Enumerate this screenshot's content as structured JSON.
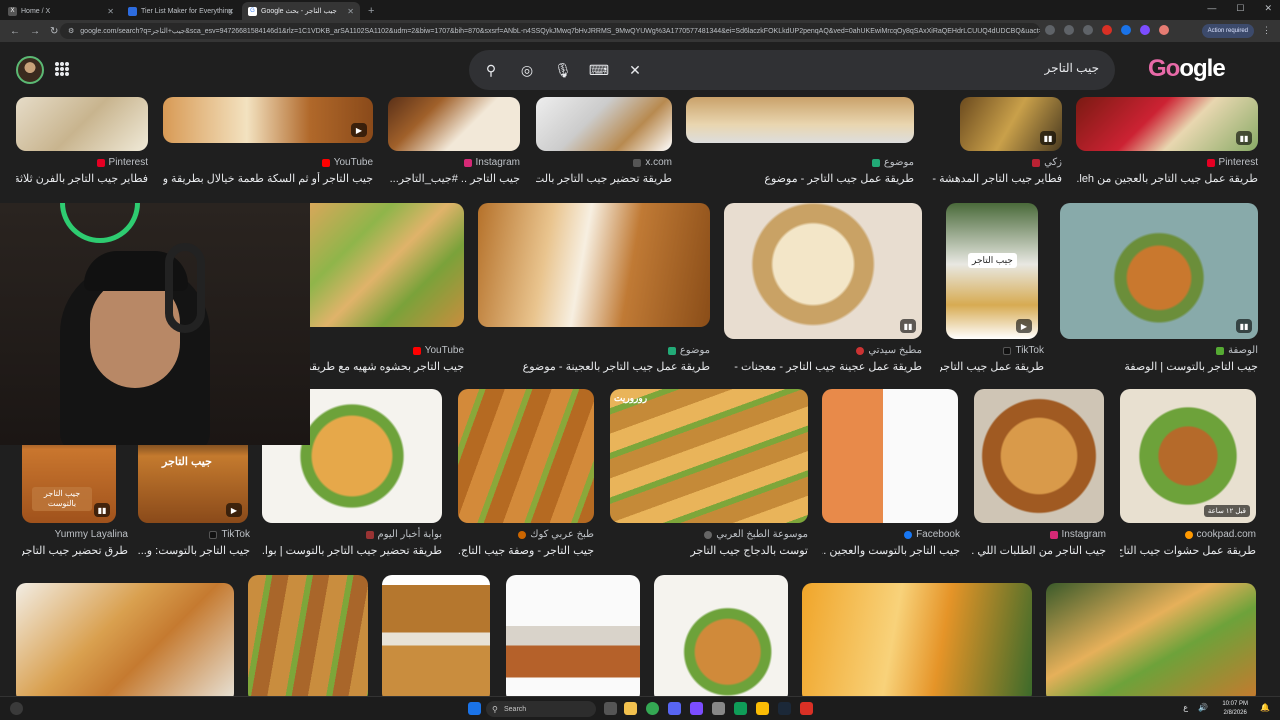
{
  "browser": {
    "tabs": [
      {
        "label": "Home / X",
        "icon": "x-icon"
      },
      {
        "label": "Tier List Maker for Everything",
        "icon": "tier-icon"
      },
      {
        "label": "جيب التاجر - بحث Google",
        "icon": "google-icon"
      }
    ],
    "url": "google.com/search?q=جيب+التاجر&sca_esv=9472668158414​6d1&rlz=1C1VDKB_arSA1102SA1102&udm=2&biw=1707&bih=870&sxsrf=ANbL-n4SSQykJMwq7bHvJRRMS_9MwQYUWg%3A1770577481344&ei=Sd6laczkFOKLkdUP2penqAQ&ved=0ahUKEwiMrcqOy8qSAxXiRaQEHdrLCUUQ4dUDCBQ&uact=5&o...",
    "action_label": "Action required"
  },
  "google": {
    "query": "جيب التاجر",
    "logo_a": "Go",
    "logo_b": "ogle"
  },
  "results": {
    "row1": [
      {
        "source": "Pinterest",
        "title": "طريقة عمل جيب التاجر بالعجين من leh...",
        "color": "#e60023"
      },
      {
        "source": "زكي",
        "title": "فطاير جيب التاجر المدهشة - ...",
        "color": "#b23"
      },
      {
        "source": "موضوع",
        "title": "طريقة عمل جيب التاجر - موضوع",
        "color": "#2a7"
      },
      {
        "source": "x.com",
        "title": "طريقة تحضير جيب التاجر بالت...",
        "color": "#555"
      },
      {
        "source": "Instagram",
        "title": "جيب التاجر .. #جيب_التاجر...",
        "color": "#d62976"
      },
      {
        "source": "YouTube",
        "title": "جيب التاجر أو ثم السكة طعمة خيالال بطريقة ولا...",
        "color": "#f00"
      },
      {
        "source": "Pinterest",
        "title": "فطاير جيب التاجر بالفرن ثلاثة...",
        "color": "#e60023"
      }
    ],
    "row2": [
      {
        "source": "الوصفة",
        "title": "جيب التاجر بالتوست | الوصفة",
        "color": "#5a3"
      },
      {
        "source": "TikTok",
        "title": "طريقة عمل جيب التاجر...",
        "color": "#111"
      },
      {
        "source": "مطبخ سيدتي",
        "title": "طريقة عمل عجينة جيب التاجر - معجنات -",
        "color": "#c33"
      },
      {
        "source": "موضوع",
        "title": "طريقة عمل جيب التاجر بالعجينة - موضوع",
        "color": "#2a7"
      },
      {
        "source": "YouTube",
        "title": "جيب التاجر بحشوه شهيه مع طريقة عمل...",
        "color": "#f00"
      }
    ],
    "row3": [
      {
        "source": "cookpad.com",
        "title": "طريقة عمل حشوات جيب التاج...",
        "color": "#f90",
        "badge": "قبل ١٢ ساعة"
      },
      {
        "source": "Instagram",
        "title": "جيب التاجر من الطلبات اللي ...",
        "color": "#d62976"
      },
      {
        "source": "Facebook",
        "title": "جيب التاجر بالتوست والعجين ...",
        "color": "#1877f2"
      },
      {
        "source": "موسوعة الطبخ العربي",
        "title": "توست بالدجاج جيب التاجر",
        "color": "#666"
      },
      {
        "source": "طبخ عربي كوك",
        "title": "جيب التاجر - وصفة جيب التاج...",
        "color": "#c60"
      },
      {
        "source": "بوابة أخبار اليوم",
        "title": "طريقة تحضير جيب التاجر بالتوست | بوا...",
        "color": "#933"
      },
      {
        "source": "TikTok",
        "title": "جيب التاجر بالتوست: و...",
        "color": "#111"
      },
      {
        "source": "Yummy Layalina",
        "title": "طرق تحضير جيب التاجر",
        "color": "#c39"
      }
    ],
    "overlay_texts": [
      "جيب التاجر",
      "جيب التاجر بالتوست",
      "جيب التاجر",
      "روروريت"
    ]
  },
  "taskbar": {
    "search_label": "Search",
    "time": "10:07 PM",
    "date": "2/8/2026",
    "lang": "ع"
  }
}
